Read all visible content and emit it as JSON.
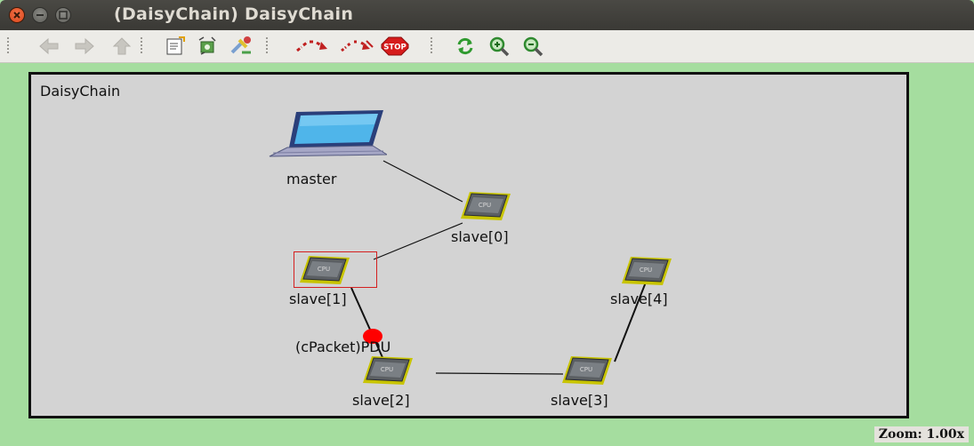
{
  "window": {
    "title": "(DaisyChain) DaisyChain"
  },
  "toolbar": {
    "buttons": [
      "back-icon",
      "forward-icon",
      "up-icon",
      "module-inspect-icon",
      "object-inspect-icon",
      "tools-icon",
      "step-icon",
      "run-icon",
      "stop-icon",
      "refresh-icon",
      "zoom-in-icon",
      "zoom-out-icon"
    ],
    "stop_label": "STOP"
  },
  "canvas": {
    "title": "DaisyChain",
    "nodes": [
      {
        "id": "master",
        "label": "master",
        "icon": "laptop-icon"
      },
      {
        "id": "slave0",
        "label": "slave[0]",
        "icon": "cpu-icon"
      },
      {
        "id": "slave1",
        "label": "slave[1]",
        "icon": "cpu-icon",
        "selected": true
      },
      {
        "id": "slave2",
        "label": "slave[2]",
        "icon": "cpu-icon"
      },
      {
        "id": "slave3",
        "label": "slave[3]",
        "icon": "cpu-icon"
      },
      {
        "id": "slave4",
        "label": "slave[4]",
        "icon": "cpu-icon"
      }
    ],
    "links": [
      [
        "master",
        "slave0"
      ],
      [
        "slave0",
        "slave1"
      ],
      [
        "slave1",
        "slave2"
      ],
      [
        "slave2",
        "slave3"
      ],
      [
        "slave3",
        "slave4"
      ]
    ],
    "message": {
      "label": "(cPacket)PDU",
      "color": "#ff0000"
    }
  },
  "status": {
    "zoom": "Zoom:  1.00x"
  },
  "colors": {
    "background": "#a5dd9f",
    "canvas": "#d3d3d3",
    "selection": "#d42020"
  }
}
